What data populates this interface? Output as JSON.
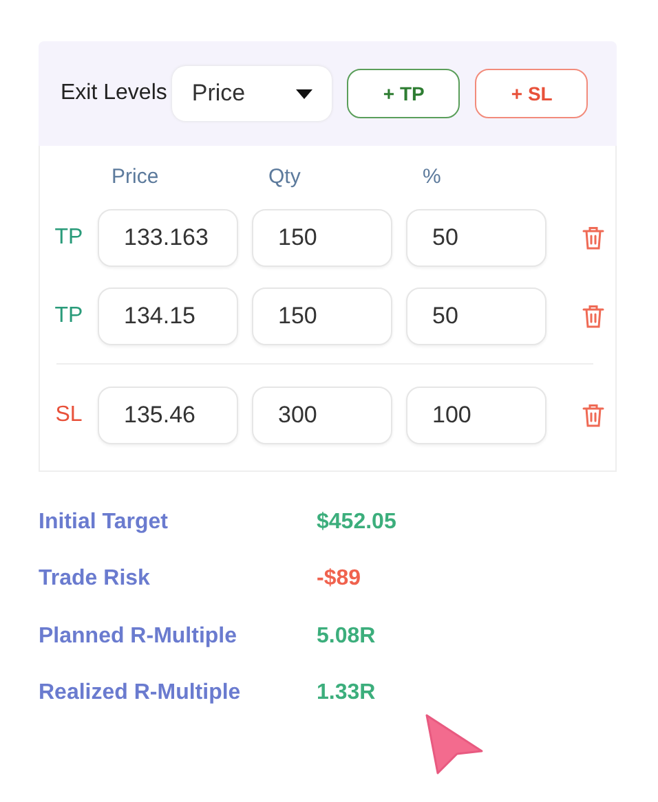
{
  "header": {
    "label": "Exit Levels",
    "select": {
      "value": "Price"
    },
    "buttons": [
      {
        "kind": "tp",
        "icon": "+",
        "label": "TP"
      },
      {
        "kind": "sl",
        "icon": "+",
        "label": "SL"
      }
    ]
  },
  "columns": [
    "Price",
    "Qty",
    "%"
  ],
  "levels": [
    {
      "kind": "tp",
      "tag": "TP",
      "price": "133.163",
      "qty": "150",
      "percent": "50"
    },
    {
      "kind": "tp",
      "tag": "TP",
      "price": "134.15",
      "qty": "150",
      "percent": "50"
    },
    {
      "kind": "sl",
      "tag": "SL",
      "price": "135.46",
      "qty": "300",
      "percent": "100"
    }
  ],
  "stats": [
    {
      "label": "Initial Target",
      "value": "$452.05",
      "kind": "positive"
    },
    {
      "label": "Trade Risk",
      "value": "-$89",
      "kind": "negative"
    },
    {
      "label": "Planned R-Multiple",
      "value": "5.08R",
      "kind": "positive"
    },
    {
      "label": "Realized R-Multiple",
      "value": "1.33R",
      "kind": "positive"
    }
  ]
}
